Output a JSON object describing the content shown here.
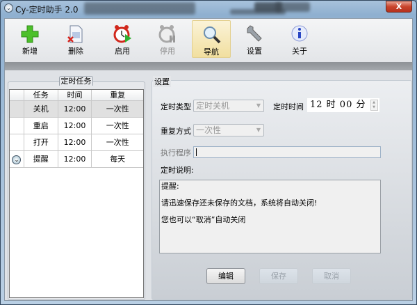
{
  "window": {
    "title": "Cy-定时助手 2.0",
    "close_label": "X"
  },
  "toolbar": {
    "items": [
      {
        "label": "新增",
        "icon": "plus-icon"
      },
      {
        "label": "删除",
        "icon": "delete-document-icon"
      },
      {
        "label": "启用",
        "icon": "alarm-play-icon"
      },
      {
        "label": "停用",
        "icon": "alarm-pause-icon"
      },
      {
        "label": "导航",
        "icon": "magnifier-icon"
      },
      {
        "label": "设置",
        "icon": "wrench-icon"
      },
      {
        "label": "关于",
        "icon": "info-icon"
      }
    ]
  },
  "tasks": {
    "group_label": "定时任务",
    "headers": [
      "任务",
      "时间",
      "重复"
    ],
    "rows": [
      {
        "task": "关机",
        "time": "12:00",
        "repeat": "一次性"
      },
      {
        "task": "重启",
        "time": "12:00",
        "repeat": "一次性"
      },
      {
        "task": "打开",
        "time": "12:00",
        "repeat": "一次性"
      },
      {
        "task": "提醒",
        "time": "12:00",
        "repeat": "每天"
      }
    ]
  },
  "settings": {
    "group_label": "设置",
    "type_label": "定时类型",
    "type_value": "定时关机",
    "time_label": "定时时间",
    "time_value": "12 时 00 分",
    "repeat_label": "重复方式",
    "repeat_value": "一次性",
    "program_label": "执行程序",
    "program_value": "",
    "desc_label": "定时说明:",
    "desc_lines": [
      "提醒:",
      "请迅速保存还未保存的文档，系统将自动关闭!",
      "您也可以“取消”自动关闭"
    ],
    "edit_label": "编辑",
    "save_label": "保存",
    "cancel_label": "取消"
  }
}
